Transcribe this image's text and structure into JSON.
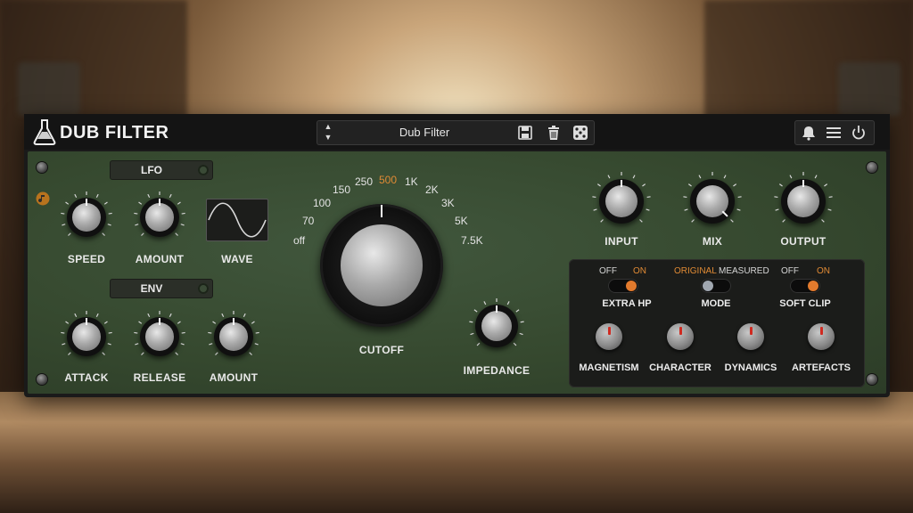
{
  "header": {
    "title": "DUB FILTER",
    "preset_name": "Dub Filter"
  },
  "lfo": {
    "label": "LFO",
    "speed_label": "SPEED",
    "amount_label": "AMOUNT",
    "wave_label": "WAVE"
  },
  "env": {
    "label": "ENV",
    "attack_label": "ATTACK",
    "release_label": "RELEASE",
    "amount_label": "AMOUNT"
  },
  "cutoff": {
    "label": "CUTOFF",
    "scale": [
      "off",
      "70",
      "100",
      "150",
      "250",
      "500",
      "1K",
      "2K",
      "3K",
      "5K",
      "7.5K"
    ],
    "active_value": "500"
  },
  "impedance_label": "IMPEDANCE",
  "io": {
    "input_label": "INPUT",
    "mix_label": "MIX",
    "output_label": "OUTPUT"
  },
  "switches": {
    "extra_hp": {
      "label": "EXTRA HP",
      "off": "OFF",
      "on": "ON",
      "state": "on"
    },
    "mode": {
      "label": "MODE",
      "left": "ORIGINAL",
      "right": "MEASURED",
      "state": "left"
    },
    "soft_clip": {
      "label": "SOFT CLIP",
      "off": "OFF",
      "on": "ON",
      "state": "on"
    }
  },
  "character_knobs": {
    "magnetism": "MAGNETISM",
    "character": "CHARACTER",
    "dynamics": "DYNAMICS",
    "artefacts": "ARTEFACTS"
  },
  "colors": {
    "accent": "#e08a34",
    "panel": "#36492f",
    "indicator": "#d02a20"
  },
  "icons": [
    "flask-icon",
    "updown-arrows-icon",
    "save-icon",
    "trash-icon",
    "dice-icon",
    "bell-icon",
    "menu-icon",
    "power-icon",
    "note-icon",
    "sine-wave-icon"
  ]
}
